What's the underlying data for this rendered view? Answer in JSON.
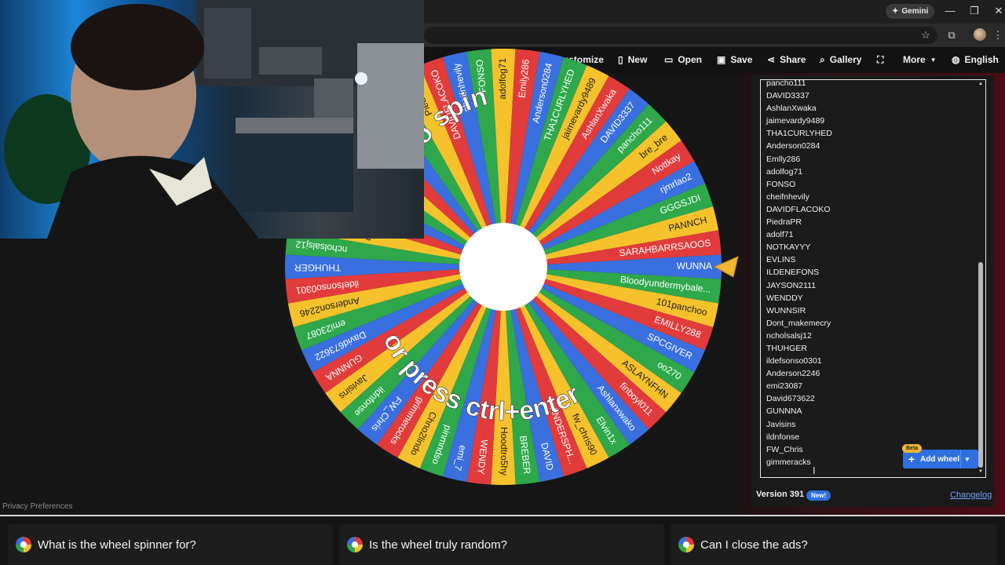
{
  "browser": {
    "gemini_label": "Gemini",
    "window_controls": [
      "—",
      "❐",
      "✕"
    ]
  },
  "toolbar": {
    "customize": "Customize",
    "new": "New",
    "open": "Open",
    "save": "Save",
    "share": "Share",
    "gallery": "Gallery",
    "more": "More",
    "language": "English"
  },
  "wheel": {
    "spin_text_top": "Click to spin",
    "spin_text_bottom": "or press ctrl+enter",
    "segment_colors": [
      "#3a6fe0",
      "#2ea84b",
      "#f5c22c",
      "#e23b3b"
    ],
    "segment_labels": [
      "WUNNA",
      "Bloodyundermybale...",
      "101panchoo",
      "EMILLY288",
      "SPCGIVER",
      "oo270",
      "ASLAYNFHN",
      "finboyl011",
      "Ashlanxwako",
      "Elvin1x",
      "fw_chris90",
      "ANDERSPH...",
      "DAVID",
      "BREBER",
      "Hoodtro5hy",
      "WENDY",
      "emi_7",
      "pinmndso",
      "Chno2lindo",
      "grimmerocks",
      "FW_Chris",
      "ildnfonse",
      "Javisins",
      "GUNNNA",
      "David673622",
      "emi23087",
      "Anderson2246",
      "ildefsonso0301",
      "THUHGER",
      "ncholsalsj12",
      "Dont_makemecry",
      "WUNNSIR",
      "WENDDY",
      "JAYSON2111",
      "ILDENEFONS",
      "EVLINS",
      "NOTKAYYY",
      "adolf71",
      "PiedraPR",
      "DAVIDFLACOKO",
      "cheifnhevily",
      "FONSO",
      "adolfog71",
      "Emily286",
      "Anderson0284",
      "THA1CURLYHED",
      "jaimevardy9489",
      "AshlanXwaka",
      "DAVID3337",
      "pancho111",
      "bre_bre",
      "Nottkay",
      "rjmrlao2",
      "GGGSJDI",
      "PANNCH",
      "SARAHBARRSAOOS"
    ]
  },
  "entries": {
    "partial_top": "pancho111",
    "items": [
      "DAVID3337",
      "AshlanXwaka",
      "jaimevardy9489",
      "THA1CURLYHED",
      "Anderson0284",
      "Emlly286",
      "adolfog71",
      "FONSO",
      "cheifnhevily",
      "DAVIDFLACOKO",
      "PiedraPR",
      "adolf71",
      "NOTKAYYY",
      "EVLINS",
      "ILDENEFONS",
      "JAYSON2111",
      "WENDDY",
      "WUNNSIR",
      "Dont_makemecry",
      "ncholsalsj12",
      "THUHGER",
      "ildefsonso0301",
      "Anderson2246",
      "emi23087",
      "David673622",
      "GUNNNA",
      "Javisins",
      "ildnfonse",
      "FW_Chris",
      "gimmeracks"
    ]
  },
  "add_wheel": {
    "label": "Add wheel",
    "beta": "Beta"
  },
  "footer": {
    "version": "Version 391",
    "new_badge": "New!",
    "changelog": "Changelog",
    "privacy": "Privacy Preferences"
  },
  "faq": [
    {
      "question": "What is the wheel spinner for?"
    },
    {
      "question": "Is the wheel truly random?"
    },
    {
      "question": "Can I close the ads?"
    }
  ],
  "colors": {
    "accent_blue": "#2f6fe0",
    "beta_yellow": "#f2b630",
    "link_blue": "#6fa3f5"
  }
}
